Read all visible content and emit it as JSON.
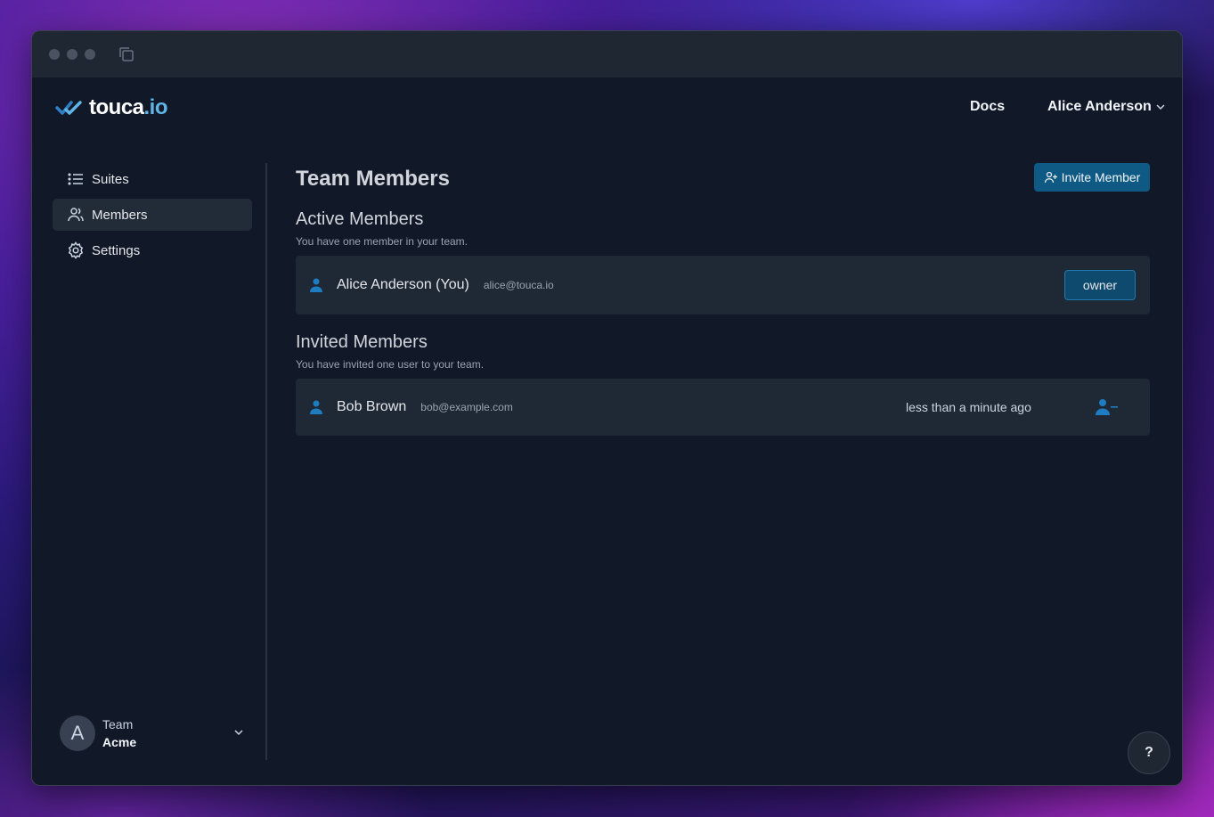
{
  "header": {
    "logo_text": "touca",
    "logo_suffix": ".io",
    "docs_label": "Docs",
    "user_name": "Alice Anderson"
  },
  "sidebar": {
    "items": [
      {
        "label": "Suites",
        "icon": "list-icon"
      },
      {
        "label": "Members",
        "icon": "users-icon",
        "active": true
      },
      {
        "label": "Settings",
        "icon": "gear-icon"
      }
    ],
    "team": {
      "avatar_letter": "A",
      "label": "Team",
      "name": "Acme"
    }
  },
  "main": {
    "title": "Team Members",
    "invite_label": "Invite Member",
    "active": {
      "title": "Active Members",
      "subtitle": "You have one member in your team.",
      "members": [
        {
          "name": "Alice Anderson (You)",
          "email": "alice@touca.io",
          "role": "owner"
        }
      ]
    },
    "invited": {
      "title": "Invited Members",
      "subtitle": "You have invited one user to your team.",
      "members": [
        {
          "name": "Bob Brown",
          "email": "bob@example.com",
          "time": "less than a minute ago"
        }
      ]
    }
  },
  "help_label": "?",
  "colors": {
    "accent": "#0e5a85",
    "brand": "#60b4e6",
    "background": "#111827"
  }
}
